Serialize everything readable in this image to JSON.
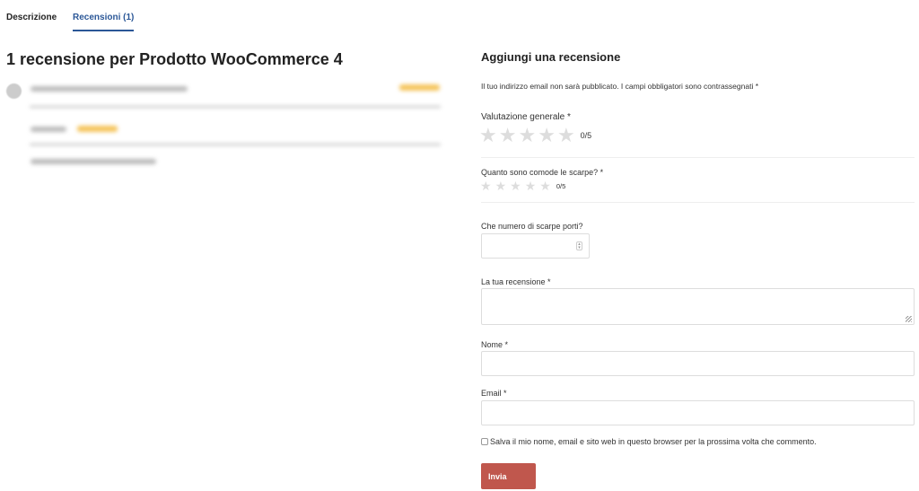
{
  "tabs": [
    {
      "label": "Descrizione",
      "active": false
    },
    {
      "label": "Recensioni (1)",
      "active": true
    }
  ],
  "reviews": {
    "title": "1 recensione per Prodotto WooCommerce 4",
    "blurred": true
  },
  "form": {
    "title": "Aggiungi una recensione",
    "notice": "Il tuo indirizzo email non sarà pubblicato. I campi obbligatori sono contrassegnati *",
    "overall_label": "Valutazione generale *",
    "overall_value": "0/5",
    "comfort_label": "Quanto sono comode le scarpe? *",
    "comfort_value": "0/5",
    "size_label": "Che numero di scarpe porti?",
    "review_label": "La tua recensione *",
    "name_label": "Nome *",
    "email_label": "Email *",
    "save_label": "Salva il mio nome, email e sito web in questo browser per la prossima volta che commento.",
    "submit_label": "Invia"
  },
  "colors": {
    "accent": "#2b5797",
    "button": "#c0574d",
    "star_empty": "#dddddd",
    "star_filled": "#f5c45a"
  }
}
